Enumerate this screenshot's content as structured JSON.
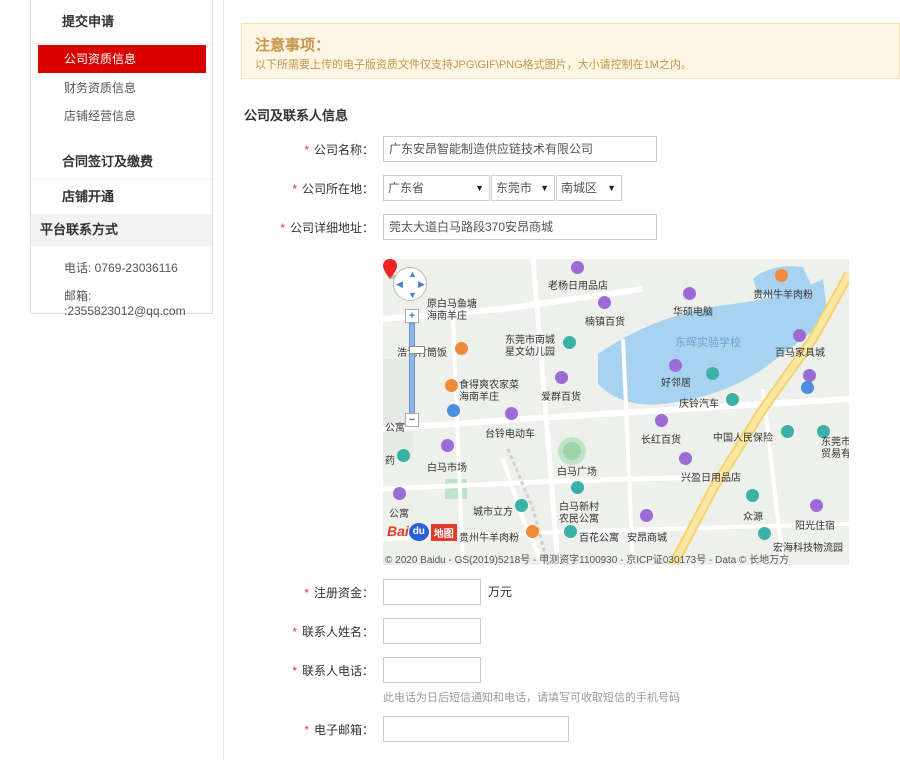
{
  "sidebar": {
    "submit_heading": "提交申请",
    "items": [
      {
        "label": "公司资质信息",
        "active": true
      },
      {
        "label": "财务资质信息",
        "active": false
      },
      {
        "label": "店铺经营信息",
        "active": false
      }
    ],
    "contract_heading": "合同签订及缴费",
    "store_open_heading": "店铺开通",
    "platform_contact_heading": "平台联系方式",
    "phone": "电话: 0769-23036116",
    "email": "邮箱: :2355823012@qq.com"
  },
  "notice": {
    "title": "注意事项：",
    "text": "以下所需要上传的电子版资质文件仅支持JPG\\GIF\\PNG格式图片，大小请控制在1M之内。"
  },
  "section": {
    "title": "公司及联系人信息"
  },
  "form": {
    "required_mark": "*",
    "company_name": {
      "label": "公司名称：",
      "value": "广东安昂智能制造供应链技术有限公司"
    },
    "company_location": {
      "label": "公司所在地：",
      "province": "广东省",
      "city": "东莞市",
      "district": "南城区"
    },
    "company_address": {
      "label": "公司详细地址：",
      "value": "莞太大道白马路段370安昂商城"
    },
    "registered_capital": {
      "label": "注册资金：",
      "value": "",
      "unit": "万元"
    },
    "contact_name": {
      "label": "联系人姓名：",
      "value": ""
    },
    "contact_phone": {
      "label": "联系人电话：",
      "value": "",
      "hint": "此电话为日后短信通知和电话，请填写可收取短信的手机号码"
    },
    "email": {
      "label": "电子邮箱：",
      "value": ""
    }
  },
  "map": {
    "copyright": "© 2020 Baidu - GS(2019)5218号 - 甲测资字1100930 - 京ICP证030173号 - Data © 长地万方",
    "logo_text": "Bai",
    "logo_du": "du",
    "logo_ditu": "地图",
    "places": [
      "老杨日用品店",
      "贵州牛羊肉粉",
      "原白马鱼塘",
      "海南羊庄",
      "楠镇百货",
      "华硕电脑",
      "东莞市南城",
      "星文幼儿园",
      "东晖实验学校",
      "百马家具城",
      "浩记竹筒饭",
      "好邻居",
      "食得爽农家菜",
      "海南羊庄",
      "爱群百货",
      "庆铃汽车",
      "台铃电动车",
      "长红百货",
      "中国人民保险",
      "东莞市",
      "贸易有",
      "白马市场",
      "白马广场",
      "兴盈日用品店",
      "城市立方",
      "白马新村",
      "农民公寓",
      "安昂商城",
      "众源",
      "阳光住宿",
      "贵州牛羊肉粉",
      "百花公寓",
      "宏海科技物流园",
      "公寓",
      "药",
      "公寓"
    ]
  },
  "colors": {
    "accent_red": "#d90000",
    "required_star": "#e4393c",
    "notice_bg": "#fdf6e4",
    "notice_text": "#c7964a"
  }
}
